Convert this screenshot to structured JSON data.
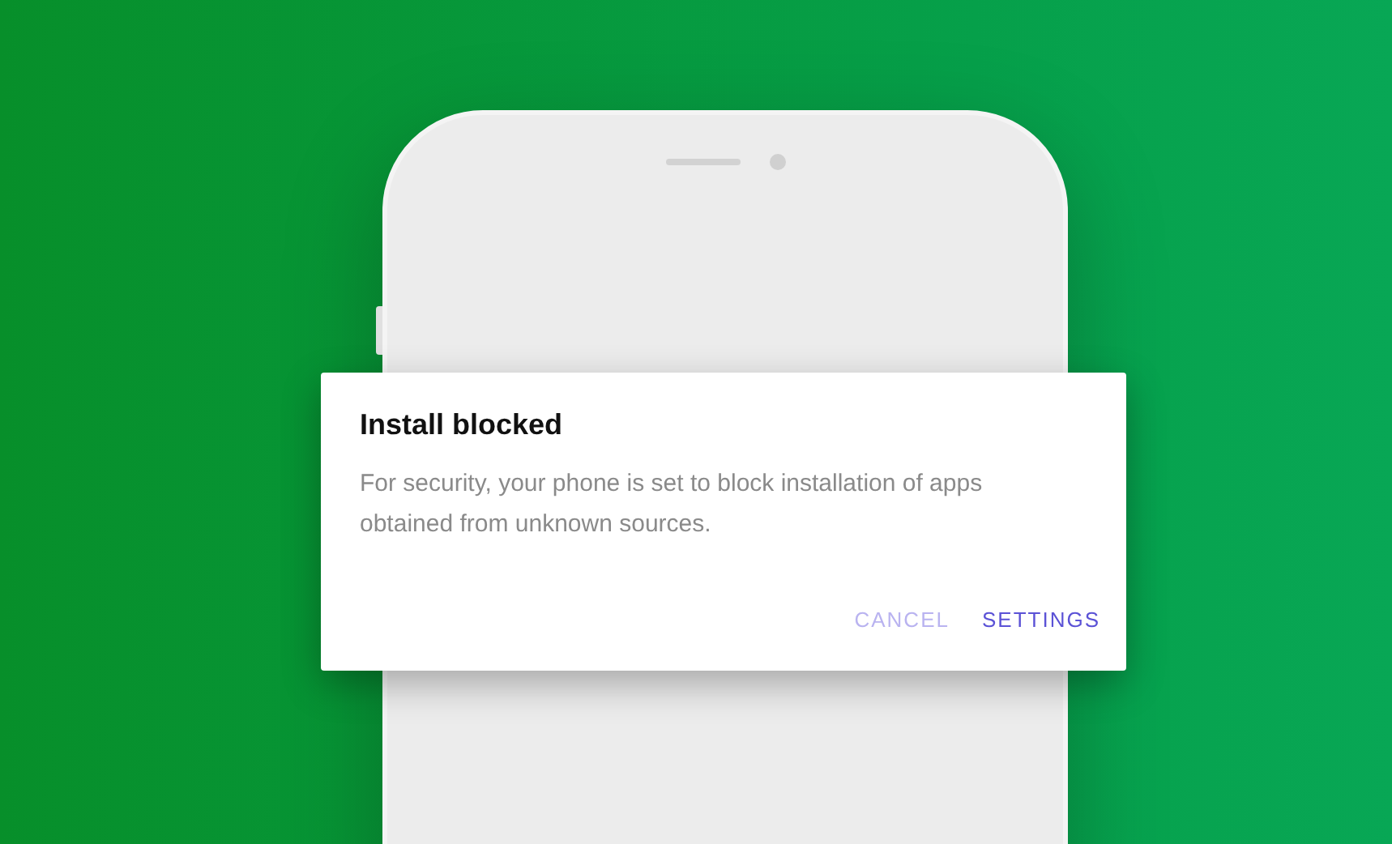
{
  "dialog": {
    "title": "Install blocked",
    "message": "For security, your phone is set to block installation of apps obtained from unknown sources.",
    "buttons": [
      {
        "label": "CANCEL",
        "kind": "secondary"
      },
      {
        "label": "SETTINGS",
        "kind": "primary"
      }
    ]
  }
}
